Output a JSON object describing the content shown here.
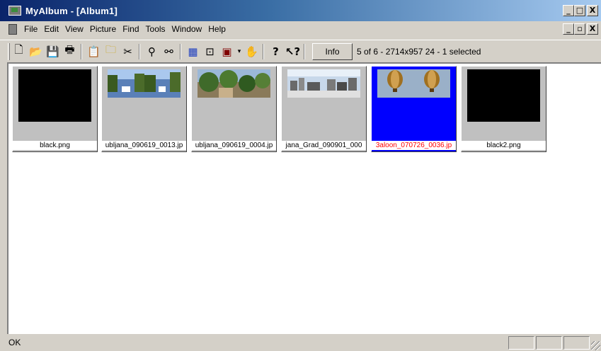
{
  "window": {
    "title": "MyAlbum - [Album1]",
    "controls": {
      "minimize": "_",
      "maximize": "□",
      "close": "X"
    },
    "mdi_controls": {
      "minimize": "_",
      "restore": "▫",
      "close": "X"
    }
  },
  "menu": {
    "items": [
      "File",
      "Edit",
      "View",
      "Picture",
      "Find",
      "Tools",
      "Window",
      "Help"
    ]
  },
  "toolbar": {
    "info_label": "Info",
    "status": "5 of 6 - 2714x957 24 - 1 selected",
    "icons": [
      "new-icon",
      "open-icon",
      "save-icon",
      "print-icon",
      "paste-icon",
      "new-folder-icon",
      "cut-icon",
      "find-icon",
      "find-similar-icon",
      "slideshow-icon",
      "zoom-icon",
      "display-icon",
      "hand-icon",
      "help-icon",
      "context-help-icon"
    ]
  },
  "thumbnails": [
    {
      "caption": "black.png",
      "kind": "black",
      "selected": false
    },
    {
      "caption": "ubljana_090619_0013.jp",
      "kind": "river",
      "selected": false
    },
    {
      "caption": "ubljana_090619_0004.jp",
      "kind": "trees",
      "selected": false
    },
    {
      "caption": "jana_Grad_090901_000",
      "kind": "city",
      "selected": false
    },
    {
      "caption": "3aloon_070726_0036.jp",
      "kind": "balloon",
      "selected": true
    },
    {
      "caption": "black2.png",
      "kind": "black",
      "selected": false
    }
  ],
  "statusbar": {
    "text": "OK"
  },
  "colors": {
    "title_start": "#0a246a",
    "title_end": "#a6caf0",
    "selection": "#0000ff",
    "selected_caption": "#ff0000"
  }
}
